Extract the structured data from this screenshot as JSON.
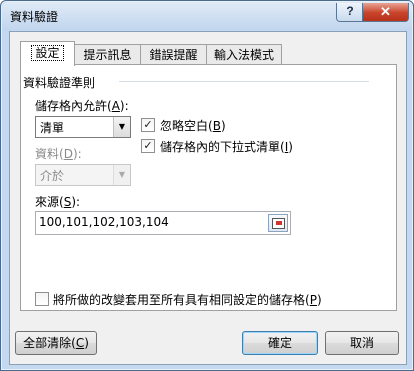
{
  "window": {
    "title": "資料驗證",
    "help_label": "?",
    "close_label": "✕"
  },
  "tabs": [
    {
      "label": "設定",
      "active": true
    },
    {
      "label": "提示訊息",
      "active": false
    },
    {
      "label": "錯誤提醒",
      "active": false
    },
    {
      "label": "輸入法模式",
      "active": false
    }
  ],
  "criteria": {
    "group_label": "資料驗證準則",
    "allow_label": "儲存格內允許",
    "allow_hotkey": "A",
    "allow_value": "清單",
    "ignore_blank_label": "忽略空白",
    "ignore_blank_hotkey": "B",
    "ignore_blank_checked": true,
    "in_cell_dropdown_label": "儲存格內的下拉式清單",
    "in_cell_dropdown_hotkey": "I",
    "in_cell_dropdown_checked": true,
    "data_label": "資料",
    "data_hotkey": "D",
    "data_value": "介於",
    "source_label": "來源",
    "source_hotkey": "S",
    "source_value": "100,101,102,103,104"
  },
  "apply_all": {
    "label": "將所做的改變套用至所有具有相同設定的儲存格",
    "hotkey": "P",
    "checked": false
  },
  "buttons": {
    "clear_all_label": "全部清除",
    "clear_all_hotkey": "C",
    "ok_label": "確定",
    "cancel_label": "取消"
  },
  "icons": {
    "help": "question-icon",
    "close": "close-icon",
    "dropdown": "chevron-down-icon",
    "ref": "range-select-icon"
  }
}
